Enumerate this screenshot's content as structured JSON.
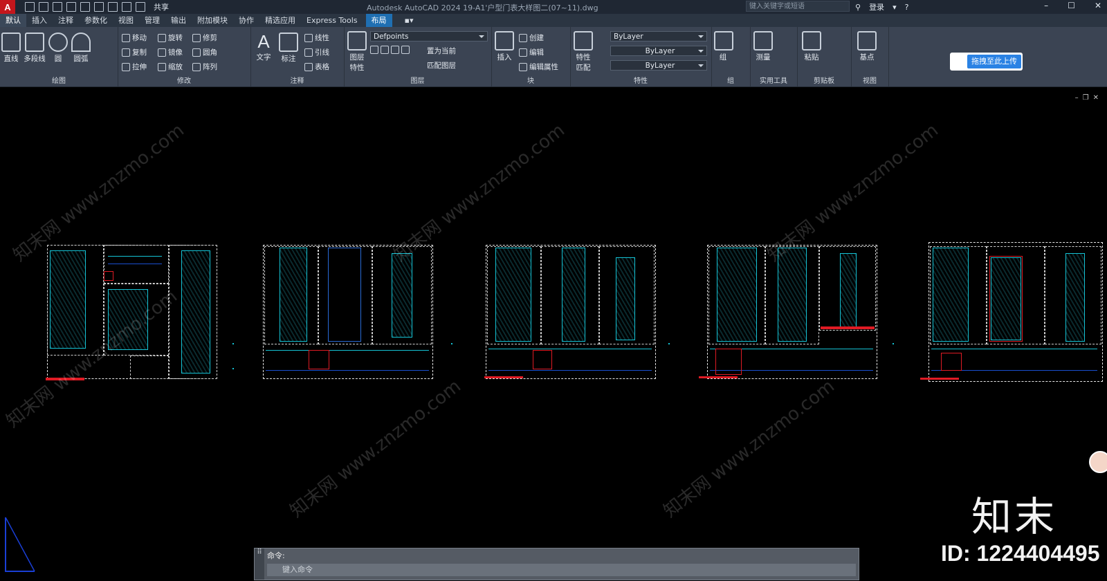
{
  "titlebar": {
    "app_letter": "A",
    "share": "共享",
    "title": "Autodesk AutoCAD 2024    19-A1'户型门表大样图二(07~11).dwg",
    "search_placeholder": "键入关键字或短语",
    "login": "登录"
  },
  "tabs": [
    "默认",
    "插入",
    "注释",
    "参数化",
    "视图",
    "管理",
    "输出",
    "附加模块",
    "协作",
    "精选应用",
    "Express Tools"
  ],
  "active_tab": "布局",
  "ribbon": {
    "draw": {
      "line": "直线",
      "polyline": "多段线",
      "circle": "圆",
      "arc": "圆弧",
      "label": "绘图"
    },
    "modify": {
      "move": "移动",
      "rotate": "旋转",
      "trim": "修剪",
      "copy": "复制",
      "mirror": "镜像",
      "fillet": "圆角",
      "stretch": "拉伸",
      "scale": "缩放",
      "array": "阵列",
      "label": "修改"
    },
    "annotation": {
      "text": "文字",
      "dimension": "标注",
      "linear": "线性",
      "leader": "引线",
      "table": "表格",
      "label": "注释"
    },
    "layers": {
      "layer_props": "图层特性",
      "current_layer": "Defpoints",
      "set_current": "置为当前",
      "match_layer": "匹配图层",
      "label": "图层"
    },
    "block": {
      "insert": "插入",
      "create": "创建",
      "edit": "编辑",
      "edit_attr": "编辑属性",
      "label": "块"
    },
    "properties": {
      "match": "特性匹配",
      "color": "ByLayer",
      "linetype": "ByLayer",
      "lineweight": "ByLayer",
      "label": "特性"
    },
    "groups": {
      "group": "组",
      "label": "组"
    },
    "utilities": {
      "measure": "测量",
      "label": "实用工具"
    },
    "clipboard": {
      "paste": "粘贴",
      "label": "剪贴板"
    },
    "view": {
      "base": "基点",
      "label": "视图"
    }
  },
  "upload_button": "拖拽至此上传",
  "command": {
    "history": "命令:",
    "placeholder": "键入命令"
  },
  "watermark": {
    "text": "知末网 www.znzmo.com",
    "brand": "知末",
    "id": "ID: 1224404495"
  }
}
